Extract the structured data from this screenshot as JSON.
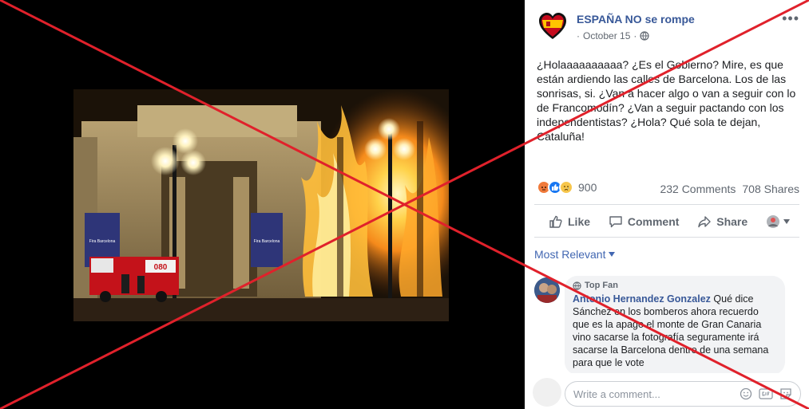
{
  "post": {
    "page_name": "ESPAÑA NO se rompe",
    "date": "October 15",
    "text": "¿Holaaaaaaaaaa? ¿Es el Gobierno? Mire, es que están ardiendo las calles de Barcelona. Los de las sonrisas, si. ¿Van a hacer algo o van a seguir con lo de Francomodín? ¿Van a seguir pactando con los independentistas? ¿Hola? Qué sola te dejan, Cataluña!",
    "reaction_count": "900",
    "comments_count": "232 Comments",
    "shares_count": "708 Shares",
    "more_label": "•••"
  },
  "photo": {
    "banner_text": "Fira Barcelona",
    "truck_number": "080"
  },
  "actions": {
    "like": "Like",
    "comment": "Comment",
    "share": "Share"
  },
  "sort": {
    "label": "Most Relevant"
  },
  "comment": {
    "badge": "Top Fan",
    "author": "Antonio Hernandez Gonzalez",
    "text": "Qué dice Sánchez en los bomberos ahora recuerdo que es la apago el monte de Gran Canaria vino sacarse la fotografía seguramente irá sacarse la Barcelona dentro de una semana para que le vote"
  },
  "composer": {
    "placeholder": "Write a comment..."
  },
  "colors": {
    "link": "#385898",
    "cross": "#e0212b",
    "angry": "#f07a3a",
    "like": "#1877f2",
    "sad": "#f7c64b"
  }
}
